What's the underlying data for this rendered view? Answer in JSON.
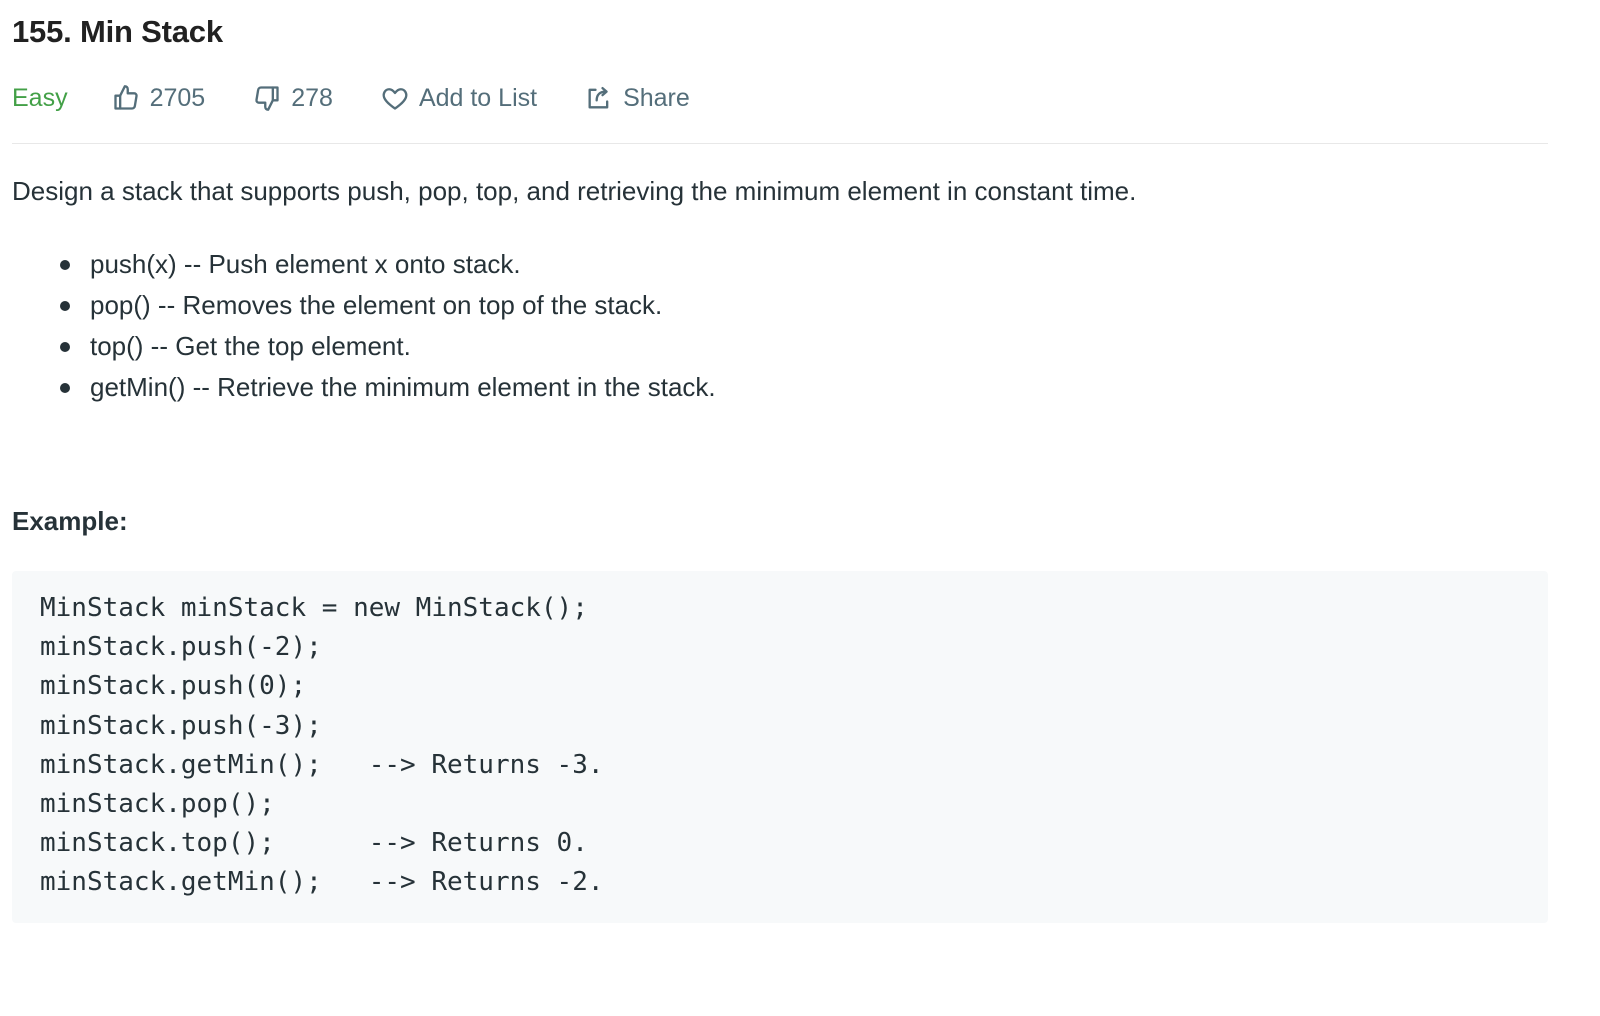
{
  "problem": {
    "title": "155. Min Stack",
    "difficulty": "Easy",
    "likes": "2705",
    "dislikes": "278",
    "add_to_list_label": "Add to List",
    "share_label": "Share"
  },
  "description": {
    "intro": "Design a stack that supports push, pop, top, and retrieving the minimum element in constant time.",
    "operations": [
      "push(x) -- Push element x onto stack.",
      "pop() -- Removes the element on top of the stack.",
      "top() -- Get the top element.",
      "getMin() -- Retrieve the minimum element in the stack."
    ]
  },
  "example": {
    "heading": "Example:",
    "code_lines": [
      "MinStack minStack = new MinStack();",
      "minStack.push(-2);",
      "minStack.push(0);",
      "minStack.push(-3);",
      "minStack.getMin();   --> Returns -3.",
      "minStack.pop();",
      "minStack.top();      --> Returns 0.",
      "minStack.getMin();   --> Returns -2."
    ]
  },
  "icons": {
    "like": "thumbs-up-icon",
    "dislike": "thumbs-down-icon",
    "add_to_list": "heart-icon",
    "share": "share-icon"
  },
  "colors": {
    "difficulty_easy": "#43a047",
    "meta_text": "#546e7a",
    "code_background": "#f7f9fa"
  }
}
